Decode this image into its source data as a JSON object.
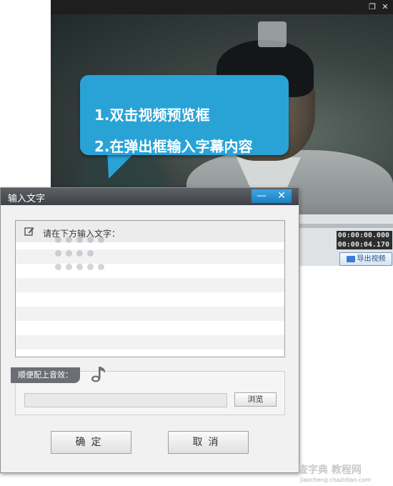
{
  "player": {
    "window_controls": {
      "restore_glyph": "❐",
      "close_glyph": "✕"
    },
    "callout": {
      "line1": "1.双击视频预览框",
      "line2": "2.在弹出框输入字幕内容"
    },
    "time": {
      "current": "00:00:00.000",
      "total": "00:00:04.170"
    },
    "export_label": "导出视频"
  },
  "dialog": {
    "title": "输入文字",
    "minimize_glyph": "—",
    "close_glyph": "✕",
    "text_prompt": "请在下方输入文字：",
    "audio_label": "顺便配上音效：",
    "audio_path_value": "",
    "browse_label": "浏览",
    "ok_label": "确定",
    "cancel_label": "取消"
  },
  "watermark": {
    "main": "查字典 教程网",
    "sub": "jiaocheng.chazidian.com"
  },
  "colors": {
    "callout": "#29a3d6",
    "titlebar": "#3e4247",
    "accent": "#1d7fc0"
  }
}
